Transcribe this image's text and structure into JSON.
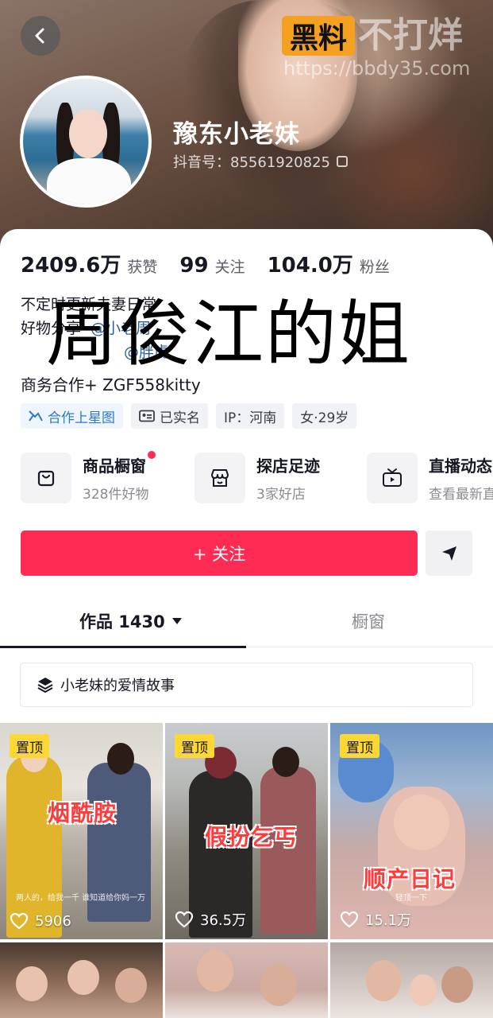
{
  "header": {
    "back_label": "",
    "watermark_brand": "黑料",
    "watermark_slogan": "不打烊",
    "watermark_url": "https://bbdy35.com",
    "name": "豫东小老妹",
    "douyin_id": "抖音号：85561920825"
  },
  "stats": {
    "likes_value": "2409.6万",
    "likes_label": "获赞",
    "following_value": "99",
    "following_label": "关注",
    "followers_value": "104.0万",
    "followers_label": "粉丝"
  },
  "bio": {
    "line1": "不定时更新夫妻日常",
    "line2_prefix": "好物分享",
    "line2_mention": "@小老周",
    "line3_mention": "@胖虎",
    "overlay": "周俊江的姐",
    "business": "商务合作+ ZGF558kitty"
  },
  "tags": [
    {
      "label": "合作上星图",
      "icon": "star-chart-icon"
    },
    {
      "label": "已实名",
      "icon": "id-card-icon"
    },
    {
      "label": "IP：河南",
      "icon": ""
    },
    {
      "label": "女·29岁",
      "icon": ""
    }
  ],
  "features": [
    {
      "title": "商品橱窗",
      "sub": "328件好物",
      "icon": "shopping-bag-icon"
    },
    {
      "title": "探店足迹",
      "sub": "3家好店",
      "icon": "store-icon"
    },
    {
      "title": "直播动态",
      "sub": "查看最新直播",
      "icon": "tv-icon"
    }
  ],
  "actions": {
    "follow_label": "+ 关注",
    "share_icon": "send-icon"
  },
  "tabs": {
    "works_label": "作品 1430",
    "window_label": "橱窗"
  },
  "collection": {
    "label": "小老妹的爱情故事"
  },
  "videos": [
    {
      "pinned": "置顶",
      "title": "烟酰胺",
      "likes": "5906",
      "caption": "两人的，给我一千 谁知道给你妈一万"
    },
    {
      "pinned": "置顶",
      "title": "假扮乞丐",
      "likes": "36.5万",
      "caption": ""
    },
    {
      "pinned": "置顶",
      "title": "顺产日记",
      "likes": "15.1万",
      "caption": "轻顶一下"
    }
  ],
  "colors": {
    "accent": "#fe2c55",
    "pin": "#fdd835",
    "link": "#2b5f9c"
  }
}
